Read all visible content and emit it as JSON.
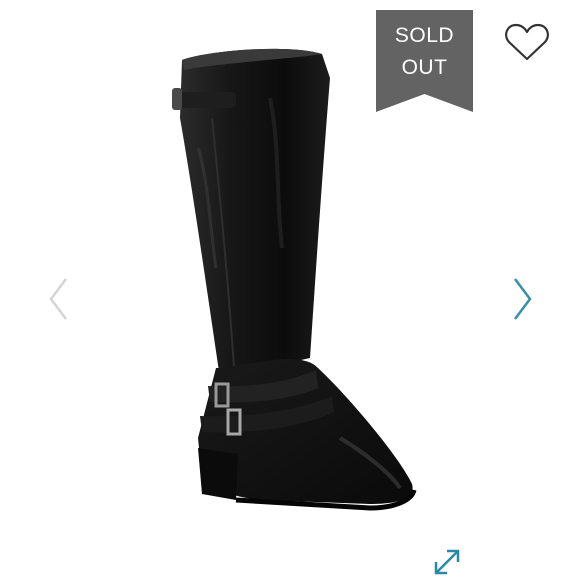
{
  "badge": {
    "line1": "SOLD",
    "line2": "OUT",
    "color": "#636363"
  },
  "icons": {
    "favorite": "heart-outline-icon",
    "previous": "chevron-left-icon",
    "next": "chevron-right-icon",
    "expand": "expand-diagonal-icon"
  },
  "colors": {
    "prev_arrow": "#d4d4d4",
    "next_arrow": "#3a8fa8",
    "expand": "#2a8aa6",
    "heart": "#333333"
  }
}
